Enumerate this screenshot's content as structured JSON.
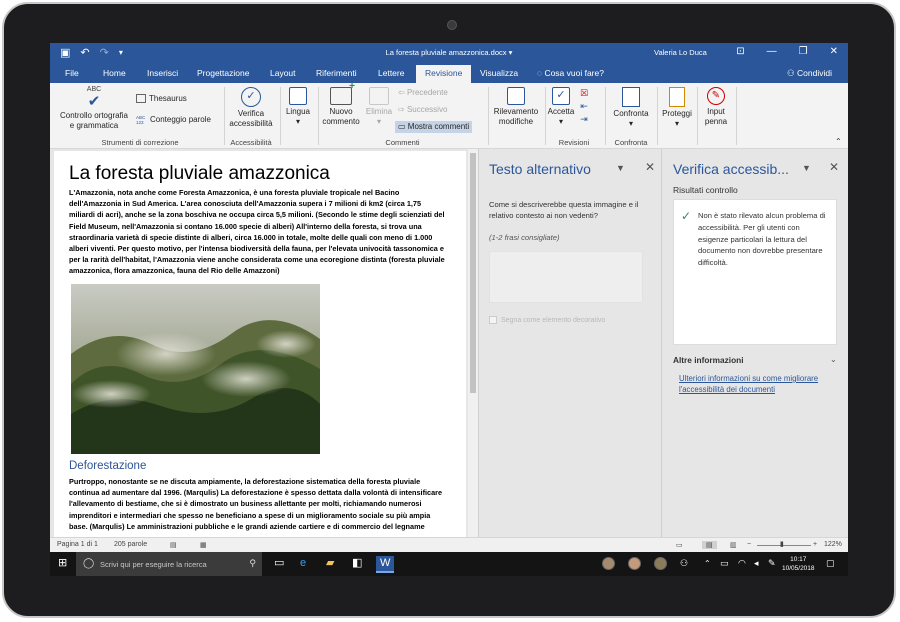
{
  "window": {
    "doc_title": "La foresta pluviale amazzonica.docx ▾",
    "user_name": "Valeria Lo Duca"
  },
  "tabs": [
    {
      "label": "File"
    },
    {
      "label": "Home"
    },
    {
      "label": "Inserisci"
    },
    {
      "label": "Progettazione"
    },
    {
      "label": "Layout"
    },
    {
      "label": "Riferimenti"
    },
    {
      "label": "Lettere"
    },
    {
      "label": "Revisione"
    },
    {
      "label": "Visualizza"
    }
  ],
  "tell_me": "Cosa vuoi fare?",
  "share_label": "Condividi",
  "ribbon": {
    "abc": "ABC",
    "abc_small": "ABC 123",
    "spelling": [
      "Controllo ortografia",
      "e grammatica"
    ],
    "thesaurus": "Thesaurus",
    "word_count": "Conteggio parole",
    "group_proofing": "Strumenti di correzione",
    "check_access": [
      "Verifica",
      "accessibilità"
    ],
    "group_access": "Accessibilità",
    "language": "Lingua",
    "new_comment": [
      "Nuovo",
      "commento"
    ],
    "delete": "Elimina",
    "previous": "Precedente",
    "next": "Successivo",
    "show_comments": "Mostra commenti",
    "group_comments": "Commenti",
    "track": [
      "Rilevamento",
      "modifiche"
    ],
    "accept": "Accetta",
    "group_changes": "Revisioni",
    "compare": "Confronta",
    "group_compare": "Confronta",
    "protect": "Proteggi",
    "ink": [
      "Input",
      "penna"
    ]
  },
  "document": {
    "title": "La foresta pluviale amazzonica",
    "paragraph1": "L'Amazzonia, nota anche come Foresta Amazzonica, è una foresta pluviale tropicale nel Bacino dell'Amazzonia in Sud America. L'area conosciuta dell'Amazzonia supera i 7 milioni di km2 (circa 1,75 miliardi di acri), anche se la zona boschiva ne occupa circa 5,5 milioni. (Secondo le stime degli scienziati del Field Museum, nell'Amazzonia si contano 16.000 specie di alberi) All'interno della foresta, si trova una straordinaria varietà di specie distinte di alberi, circa 16.000 in totale, molte delle quali con meno di 1.000 alberi viventi. Per questo motivo, per l'intensa biodiversità della fauna, per l'elevata univocità tassonomica e per la rarità dell'habitat, l'Amazzonia viene anche considerata come una ecoregione distinta (foresta pluviale amazzonica, flora amazzonica, fauna del Rio delle Amazzoni)",
    "heading2": "Deforestazione",
    "paragraph2": "Purtroppo, nonostante se ne discuta ampiamente, la deforestazione sistematica della foresta pluviale continua ad aumentare dal 1996. (Marqulis) La deforestazione è spesso dettata dalla volontà di intensificare l'allevamento di bestiame, che si è dimostrato un business allettante per molti, richiamando numerosi imprenditori e intermediari che spesso ne beneficiano a spese di un miglioramento sociale su più ampia base. (Marqulis) Le amministrazioni pubbliche e le grandi aziende cartiere e di commercio del legname"
  },
  "alt_pane": {
    "title": "Testo alternativo",
    "question": "Come si descriverebbe questa immagine e il relativo contesto ai non vedenti?",
    "hint": "(1-2 frasi consigliate)",
    "decorative": "Segna come elemento decorativo"
  },
  "acc_pane": {
    "title": "Verifica accessib...",
    "results_label": "Risultati controllo",
    "message": "Non è stato rilevato alcun problema di accessibilità. Per gli utenti con esigenze particolari la lettura del documento non dovrebbe presentare difficoltà.",
    "more_info": "Altre informazioni",
    "link": "Ulteriori informazioni su come migliorare l'accessibilità dei documenti"
  },
  "status": {
    "page": "Pagina 1 di 1",
    "words": "205 parole",
    "zoom": "122%"
  },
  "taskbar": {
    "search_placeholder": "Scrivi qui per eseguire la ricerca",
    "time": "10:17",
    "date": "10/05/2018"
  },
  "colors": {
    "word_blue": "#2b579a",
    "ribbon_bg": "#f3f3f3",
    "pane_bg": "#e6e6e6",
    "success_green": "#2e8b57"
  }
}
